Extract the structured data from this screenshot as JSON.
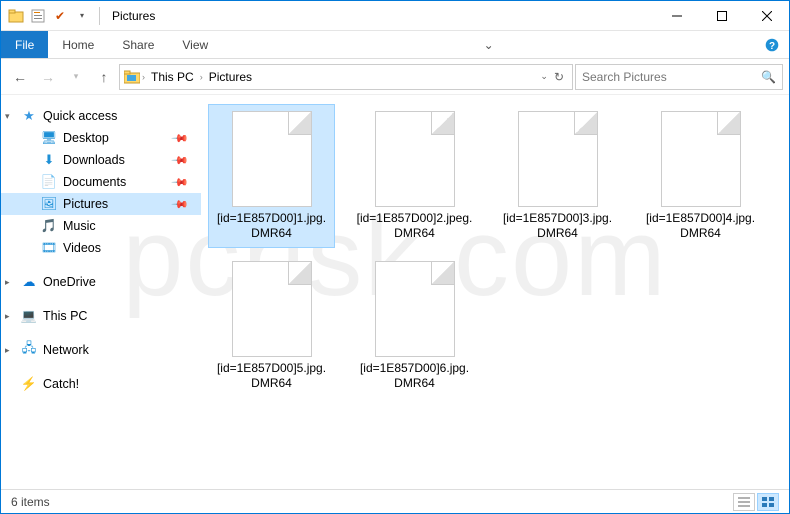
{
  "window": {
    "title": "Pictures"
  },
  "ribbon": {
    "file": "File",
    "home": "Home",
    "share": "Share",
    "view": "View"
  },
  "breadcrumb": {
    "root_sep": "›",
    "pc": "This PC",
    "pc_sep": "›",
    "folder": "Pictures"
  },
  "search": {
    "placeholder": "Search Pictures"
  },
  "nav": {
    "quick_access": "Quick access",
    "desktop": "Desktop",
    "downloads": "Downloads",
    "documents": "Documents",
    "pictures": "Pictures",
    "music": "Music",
    "videos": "Videos",
    "onedrive": "OneDrive",
    "this_pc": "This PC",
    "network": "Network",
    "catch": "Catch!"
  },
  "files": [
    "[id=1E857D00]1.jpg.DMR64",
    "[id=1E857D00]2.jpeg.DMR64",
    "[id=1E857D00]3.jpg.DMR64",
    "[id=1E857D00]4.jpg.DMR64",
    "[id=1E857D00]5.jpg.DMR64",
    "[id=1E857D00]6.jpg.DMR64"
  ],
  "status": {
    "count": "6 items"
  }
}
